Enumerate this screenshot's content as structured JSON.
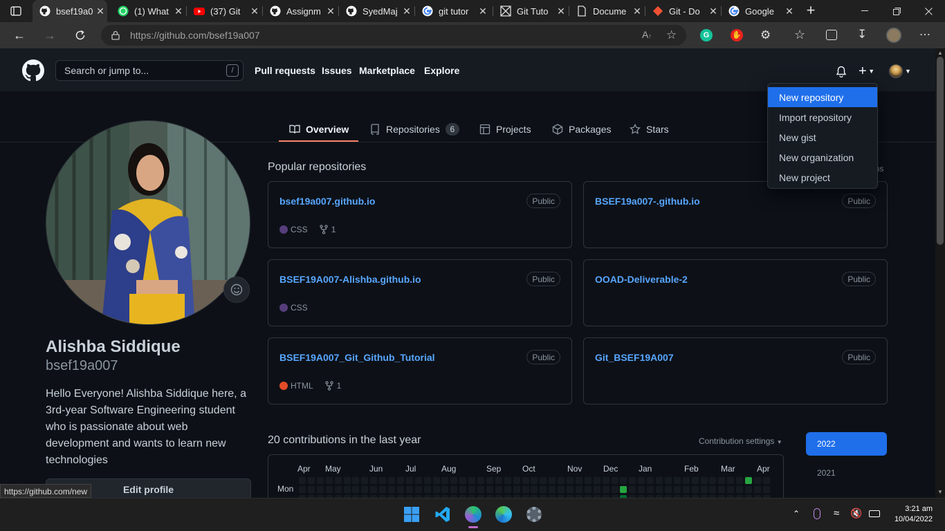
{
  "browser": {
    "tabs": [
      {
        "label": "bsef19a0",
        "icon": "github-icon",
        "active": true
      },
      {
        "label": "(1) What",
        "icon": "whatsapp-icon"
      },
      {
        "label": "(37) Git",
        "icon": "youtube-icon"
      },
      {
        "label": "Assignm",
        "icon": "github-icon"
      },
      {
        "label": "SyedMaj",
        "icon": "github-icon"
      },
      {
        "label": "git tutor",
        "icon": "google-icon"
      },
      {
        "label": "Git Tuto",
        "icon": "site-icon"
      },
      {
        "label": "Docume",
        "icon": "document-icon"
      },
      {
        "label": "Git - Do",
        "icon": "git-icon"
      },
      {
        "label": "Google",
        "icon": "google-icon"
      }
    ],
    "url": "https://github.com/bsef19a007",
    "status_link": "https://github.com/new"
  },
  "header": {
    "search_placeholder": "Search or jump to...",
    "search_shortcut": "/",
    "nav": [
      "Pull requests",
      "Issues",
      "Marketplace",
      "Explore"
    ]
  },
  "dropdown": {
    "items": [
      "New repository",
      "Import repository",
      "New gist",
      "New organization",
      "New project"
    ]
  },
  "profile_tabs": {
    "overview": "Overview",
    "repositories": "Repositories",
    "repositories_count": "6",
    "projects": "Projects",
    "packages": "Packages",
    "stars": "Stars"
  },
  "profile": {
    "name": "Alishba Siddique",
    "login": "bsef19a007",
    "bio": "Hello Everyone! Alishba Siddique here, a 3rd-year Software Engineering student who is passionate about web development and wants to learn new technologies",
    "edit_label": "Edit profile"
  },
  "popular": {
    "title": "Popular repositories",
    "customize": "ins",
    "repos": [
      {
        "name": "bsef19a007.github.io",
        "visibility": "Public",
        "language": "CSS",
        "lang_color": "#563d7c",
        "forks": "1"
      },
      {
        "name": "BSEF19a007-.github.io",
        "visibility": "Public"
      },
      {
        "name": "BSEF19A007-Alishba.github.io",
        "visibility": "Public",
        "language": "CSS",
        "lang_color": "#563d7c"
      },
      {
        "name": "OOAD-Deliverable-2",
        "visibility": "Public"
      },
      {
        "name": "BSEF19A007_Git_Github_Tutorial",
        "visibility": "Public",
        "language": "HTML",
        "lang_color": "#e34c26",
        "forks": "1"
      },
      {
        "name": "Git_BSEF19A007",
        "visibility": "Public"
      }
    ]
  },
  "contributions": {
    "title": "20 contributions in the last year",
    "settings": "Contribution settings",
    "months": [
      "Apr",
      "May",
      "Jun",
      "Jul",
      "Aug",
      "Sep",
      "Oct",
      "Nov",
      "Dec",
      "Jan",
      "Feb",
      "Mar",
      "Apr"
    ],
    "day_label": "Mon",
    "years": [
      "2022",
      "2021"
    ]
  },
  "taskbar": {
    "time": "3:21 am",
    "date": "10/04/2022"
  }
}
